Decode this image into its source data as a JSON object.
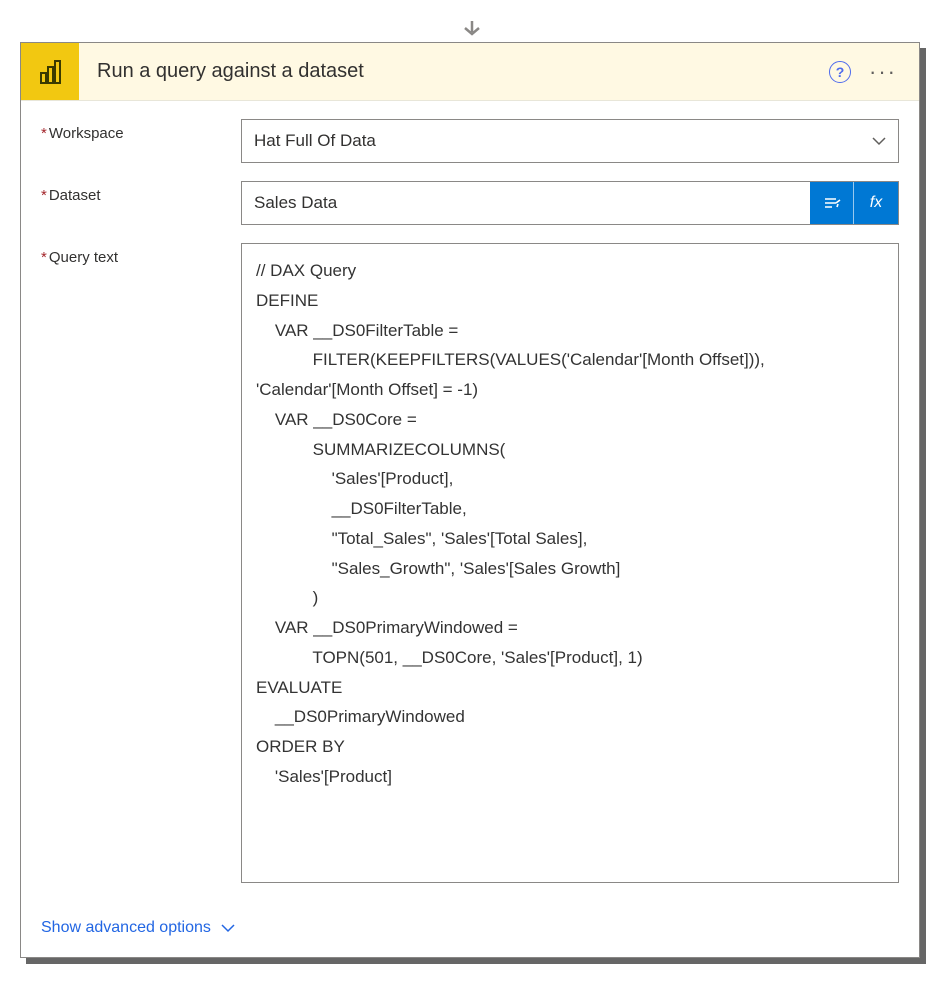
{
  "header": {
    "title": "Run a query against a dataset"
  },
  "fields": {
    "workspace": {
      "label": "Workspace",
      "value": "Hat Full Of Data"
    },
    "dataset": {
      "label": "Dataset",
      "value": "Sales Data"
    },
    "query": {
      "label": "Query text",
      "value": "// DAX Query\nDEFINE\n    VAR __DS0FilterTable =\n            FILTER(KEEPFILTERS(VALUES('Calendar'[Month Offset])),\n'Calendar'[Month Offset] = -1)\n    VAR __DS0Core =\n            SUMMARIZECOLUMNS(\n                'Sales'[Product],\n                __DS0FilterTable,\n                \"Total_Sales\", 'Sales'[Total Sales],\n                \"Sales_Growth\", 'Sales'[Sales Growth]\n            )\n    VAR __DS0PrimaryWindowed =\n            TOPN(501, __DS0Core, 'Sales'[Product], 1)\nEVALUATE\n    __DS0PrimaryWindowed\nORDER BY\n    'Sales'[Product]"
    }
  },
  "footer": {
    "advanced": "Show advanced options"
  },
  "icons": {
    "help": "?",
    "more": "···",
    "fx": "fx"
  }
}
